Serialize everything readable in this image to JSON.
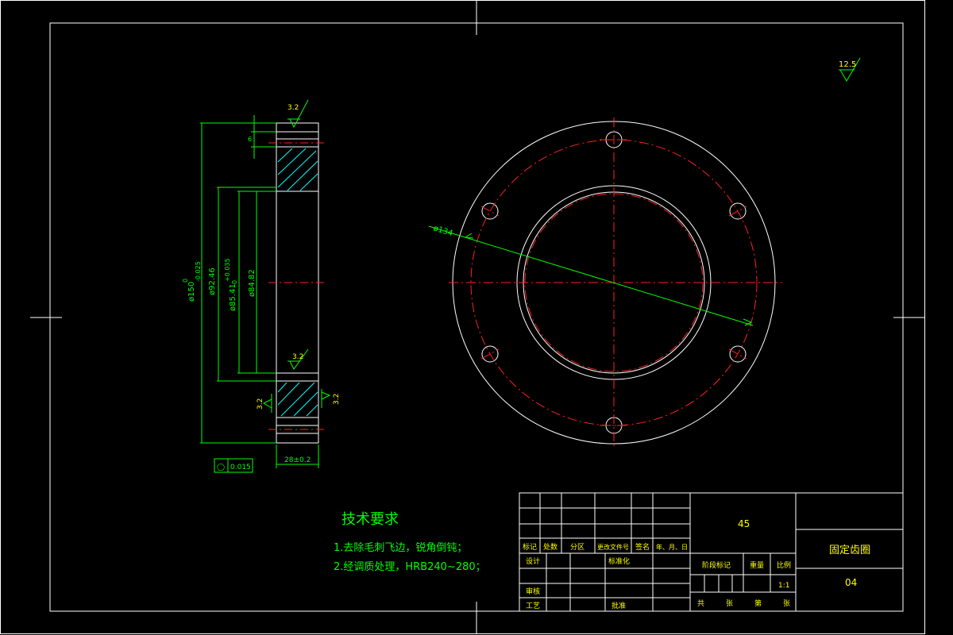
{
  "surface_finish": {
    "general": "12.5",
    "face_top": "3.2",
    "face_bottom": "3.2",
    "side_left": "3.2",
    "side_right": "3.2"
  },
  "dimensions": {
    "outer_dia": "ø150",
    "outer_dia_tol_upper": "0",
    "outer_dia_tol_lower": "-0.025",
    "dia_92": "ø92.46",
    "dia_85": "ø85.41",
    "dia_85_tol_upper": "+0.035",
    "dia_85_tol_lower": "0",
    "dia_84": "ø84.82",
    "hole_circle": "ø134",
    "thickness": "28±0.2",
    "small_dim": "6"
  },
  "tolerance_frame": {
    "symbol": "◯",
    "value": "0.015"
  },
  "tech_requirements": {
    "title": "技术要求",
    "item1": "1.去除毛刺飞边，锐角倒钝；",
    "item2": "2.经调质处理，HRB240~280；"
  },
  "title_block": {
    "material": "45",
    "part_name": "固定齿圈",
    "drawing_no": "04",
    "scale": "1:1",
    "h_mark": "标记",
    "h_count": "处数",
    "h_zone": "分区",
    "h_docno": "更改文件号",
    "h_sign": "签名",
    "h_date": "年、月、日",
    "h_design": "设计",
    "h_std": "标准化",
    "h_review": "审核",
    "h_process": "工艺",
    "h_approve": "批准",
    "h_stage": "阶段标记",
    "h_weight": "重量",
    "h_scale": "比例",
    "h_total": "共",
    "h_sheets": "张",
    "h_sheetno": "第",
    "h_sheet": "张"
  },
  "colors": {
    "outline": "#ffffff",
    "dimension": "#00ff00",
    "center": "#ff2020",
    "hatch": "#00ffff",
    "text": "#ffff00"
  }
}
